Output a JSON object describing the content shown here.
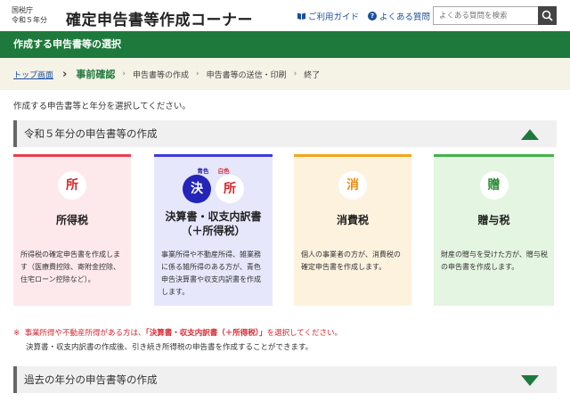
{
  "header": {
    "agency_line1": "国税庁",
    "agency_line2": "令和５年分",
    "title": "確定申告書等作成コーナー",
    "guide_link": "ご利用ガイド",
    "faq_link": "よくある質問",
    "search_placeholder": "よくある質問を検索"
  },
  "page_heading": "作成する申告書等の選択",
  "breadcrumb": {
    "items": [
      "トップ画面",
      "事前確認",
      "申告書等の作成",
      "申告書等の送信・印刷",
      "終了"
    ]
  },
  "instruction": "作成する申告書等と年分を選択してください。",
  "current_section": {
    "title": "令和５年分の申告書等の作成"
  },
  "cards": [
    {
      "badge": "所",
      "name": "所得税",
      "description": "所得税の確定申告書を作成します（医療費控除、寄附金控除、住宅ローン控除など）。"
    },
    {
      "tag_blue": "青色",
      "tag_red": "白色",
      "badge_blue": "決",
      "badge_red": "所",
      "name_line1": "決算書・収支内訳書",
      "name_line2": "（＋所得税）",
      "description": "事業所得や不動産所得、雑業務に係る雑所得のある方が、青色申告決算書や収支内訳書を作成します。"
    },
    {
      "badge": "消",
      "name": "消費税",
      "description": "個人の事業者の方が、消費税の確定申告書を作成します。"
    },
    {
      "badge": "贈",
      "name": "贈与税",
      "description": "財産の贈与を受けた方が、贈与税の申告書を作成します。"
    }
  ],
  "note": {
    "mark": "※",
    "text_before": "事業所得や不動産所得がある方は、",
    "highlight": "「決算書・収支内訳書（＋所得税）」",
    "text_after": "を選択してください。",
    "line2": "決算書・収支内訳書の作成後、引き続き所得税の申告書を作成することができます。"
  },
  "past_section": {
    "title": "過去の年分の申告書等の作成"
  },
  "colors": {
    "brand_green": "#1e7a3c",
    "income_tax": "#e8404e",
    "settlement": "#3a3ad8",
    "consumption_tax": "#f5a41a",
    "gift_tax": "#44b34a"
  }
}
